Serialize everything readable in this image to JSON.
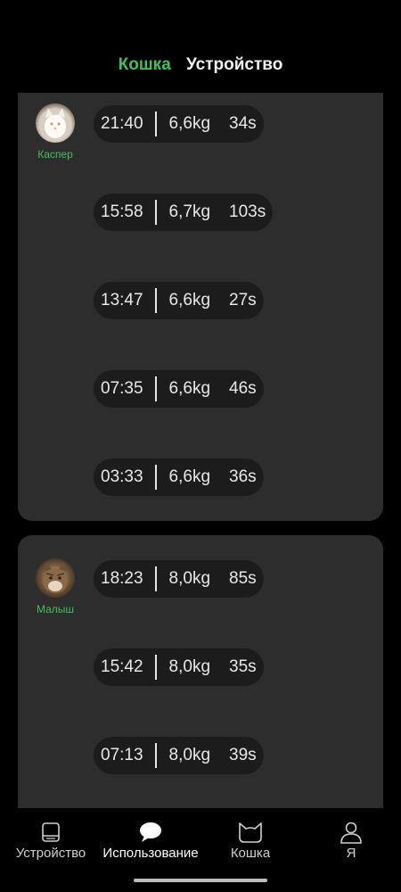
{
  "top_tabs": {
    "active": "Кошка",
    "inactive": "Устройство"
  },
  "cards": [
    {
      "cat_name": "Каспер",
      "records": [
        {
          "time": "21:40",
          "weight": "6,6kg",
          "duration": "34s"
        },
        {
          "time": "15:58",
          "weight": "6,7kg",
          "duration": "103s"
        },
        {
          "time": "13:47",
          "weight": "6,6kg",
          "duration": "27s"
        },
        {
          "time": "07:35",
          "weight": "6,6kg",
          "duration": "46s"
        },
        {
          "time": "03:33",
          "weight": "6,6kg",
          "duration": "36s"
        }
      ]
    },
    {
      "cat_name": "Малыш",
      "records": [
        {
          "time": "18:23",
          "weight": "8,0kg",
          "duration": "85s"
        },
        {
          "time": "15:42",
          "weight": "8,0kg",
          "duration": "35s"
        },
        {
          "time": "07:13",
          "weight": "8,0kg",
          "duration": "39s"
        }
      ]
    }
  ],
  "bottom_nav": [
    {
      "label": "Устройство",
      "icon": "device-icon"
    },
    {
      "label": "Использование",
      "icon": "chat-icon",
      "active": true
    },
    {
      "label": "Кошка",
      "icon": "cat-icon"
    },
    {
      "label": "Я",
      "icon": "person-icon"
    }
  ],
  "colors": {
    "accent": "#3ec25a",
    "card_bg": "#2d2d2d",
    "pill_bg": "#1c1c1c"
  }
}
